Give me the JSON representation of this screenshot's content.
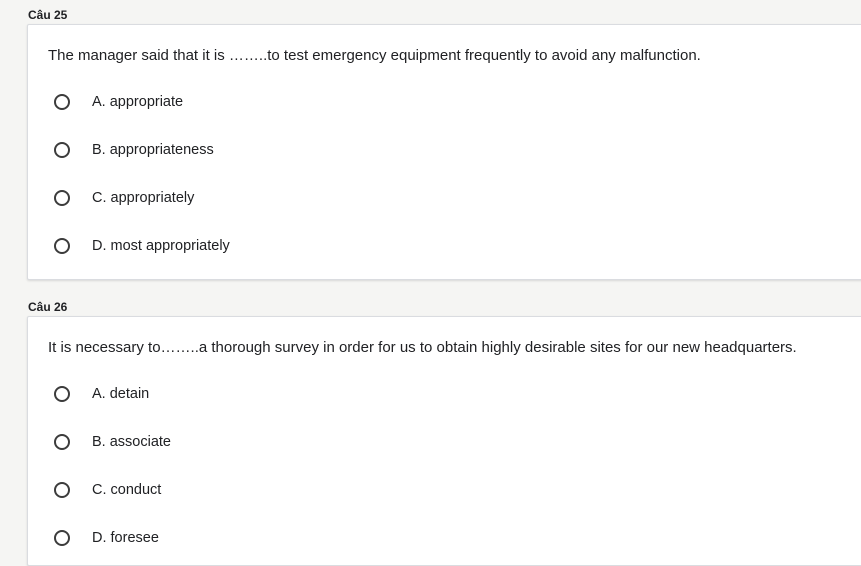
{
  "questions": [
    {
      "label": "Câu 25",
      "text": "The manager said that it is ……..to test emergency equipment frequently to avoid any malfunction.",
      "options": [
        "A. appropriate",
        "B. appropriateness",
        "C. appropriately",
        "D. most appropriately"
      ]
    },
    {
      "label": "Câu 26",
      "text": "It is necessary to……..a thorough survey in order for us to obtain highly desirable sites for our new headquarters.",
      "options": [
        "A. detain",
        "B. associate",
        "C. conduct",
        "D. foresee"
      ]
    }
  ],
  "colors": {
    "page_background": "#f5f5f3",
    "card_background": "#ffffff",
    "card_border": "#dadce0",
    "text": "#202124",
    "radio_border": "#3c3c3c"
  },
  "icons": {
    "radio": "radio-unchecked-icon"
  }
}
